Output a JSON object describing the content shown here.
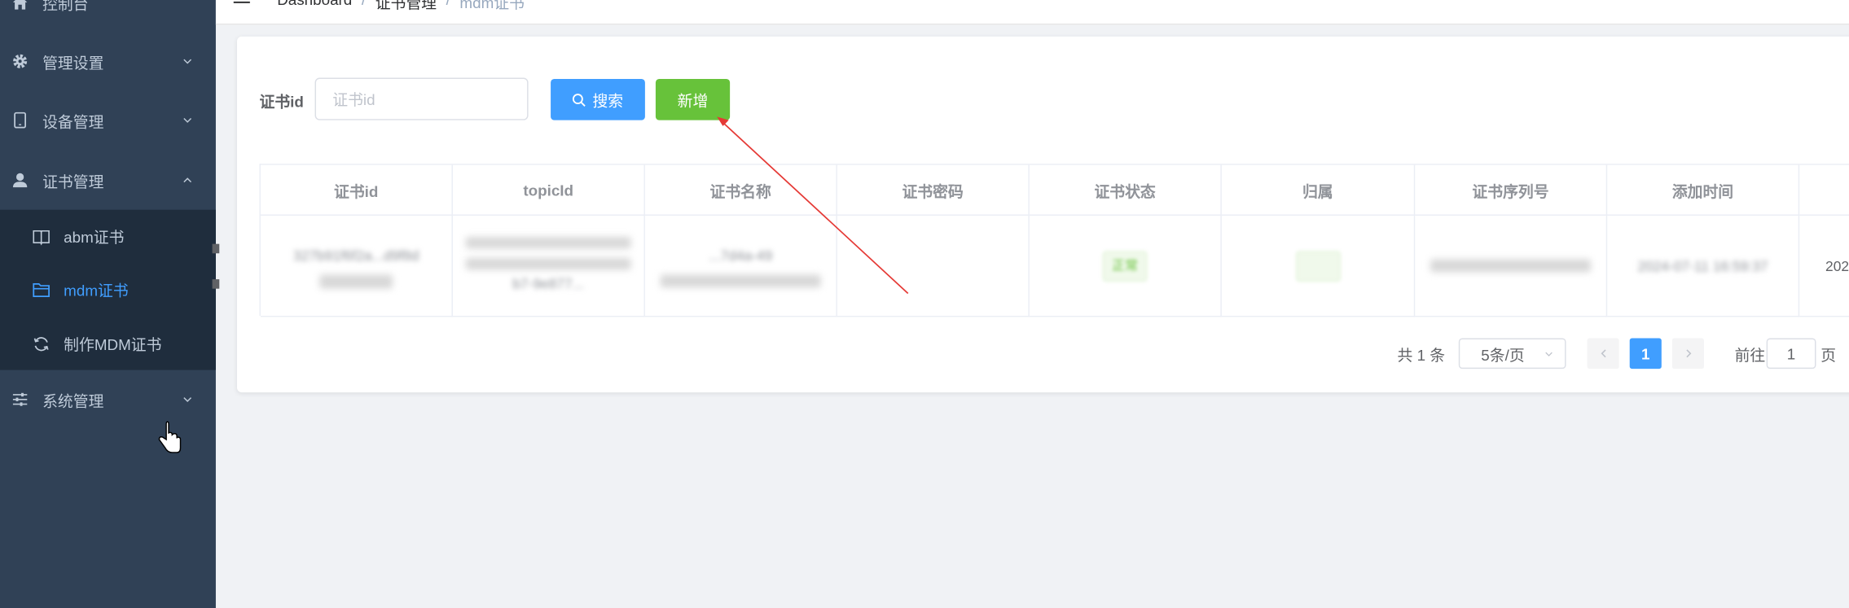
{
  "sidebar": {
    "items": [
      {
        "label": "控制台",
        "icon": "home-icon"
      },
      {
        "label": "管理设置",
        "icon": "gear-icon"
      },
      {
        "label": "设备管理",
        "icon": "tablet-icon"
      },
      {
        "label": "证书管理",
        "icon": "user-icon"
      },
      {
        "label": "系统管理",
        "icon": "sliders-icon"
      }
    ],
    "submenu": [
      {
        "label": "abm证书",
        "icon": "book-icon"
      },
      {
        "label": "mdm证书",
        "icon": "folder-icon",
        "active": true
      },
      {
        "label": "制作MDM证书",
        "icon": "refresh-icon"
      }
    ],
    "colors": {
      "background": "#304156",
      "submenu_background": "#1f2d3d",
      "active": "#409eff"
    }
  },
  "navbar": {
    "breadcrumb": [
      "Dashboard",
      "/",
      "证书管理",
      "/",
      "mdm证书"
    ]
  },
  "filter": {
    "label": "证书id",
    "placeholder": "证书id",
    "search_label": "搜索",
    "add_label": "新增"
  },
  "table": {
    "columns": [
      "证书id",
      "topicId",
      "证书名称",
      "证书密码",
      "证书状态",
      "归属",
      "证书序列号",
      "添加时间"
    ],
    "rows": [
      {
        "cert_id": "327b91f6f2a...d9f8d",
        "topic_id": "b7-9e877...",
        "cert_name": "...7d4a-49",
        "cert_password": "",
        "status": "正常",
        "owner": "",
        "serial": "",
        "added_time": "2024-07-11 16:59:37",
        "extra": "202"
      }
    ]
  },
  "pagination": {
    "total": "共 1 条",
    "page_size": "5条/页",
    "current_page": "1",
    "goto_label": "前往",
    "goto_value": "1",
    "page_suffix": "页"
  }
}
